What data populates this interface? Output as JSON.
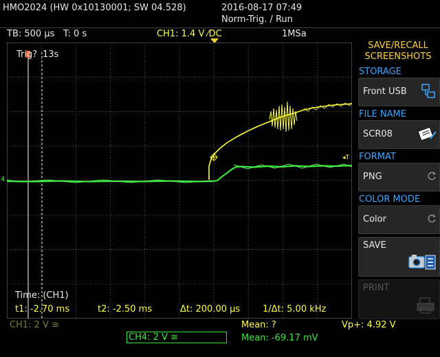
{
  "header": {
    "device": "HMO2024 (HW 0x10130001; SW 04.528)",
    "datetime": "2016-08-17 07:49",
    "status": "Norm-Trig. / Run"
  },
  "info_bar": {
    "timebase": "TB: 500 µs",
    "trigger_time": "T: 0 s",
    "channel": "CH1: 1.4 V ⁄DC",
    "sample_rate": "1MSa"
  },
  "screen": {
    "trig_label": "Trig?",
    "trig_time": "13s",
    "ch4_marker": "4",
    "trig_marker": "◂T",
    "cursor_header": "Time: (CH1)",
    "t1": "t1: -2.70 ms",
    "t2": "t2: -2.50 ms",
    "dt": "Δt: 200.00 µs",
    "inv_dt": "1/Δt: 5.00 kHz"
  },
  "menu": {
    "title_line1": "SAVE/RECALL",
    "title_line2": "SCREENSHOTS",
    "storage_label": "STORAGE",
    "storage_value": "Front USB",
    "filename_label": "FILE NAME",
    "filename_value": "SCR08",
    "format_label": "FORMAT",
    "format_value": "PNG",
    "colormode_label": "COLOR MODE",
    "colormode_value": "Color",
    "save_label": "SAVE",
    "print_label": "PRINT"
  },
  "bottom": {
    "ch1": "CH1: 2 V ≅",
    "ch4": "CH4: 2 V ≅",
    "mean1": "Mean: ?",
    "vp": "Vp+: 4.92 V",
    "mean4": "Mean: -69.17 mV"
  },
  "colors": {
    "ch1": "#ffff3c",
    "ch4": "#39e639",
    "accent": "#ffd23c",
    "section": "#39a7ff"
  }
}
